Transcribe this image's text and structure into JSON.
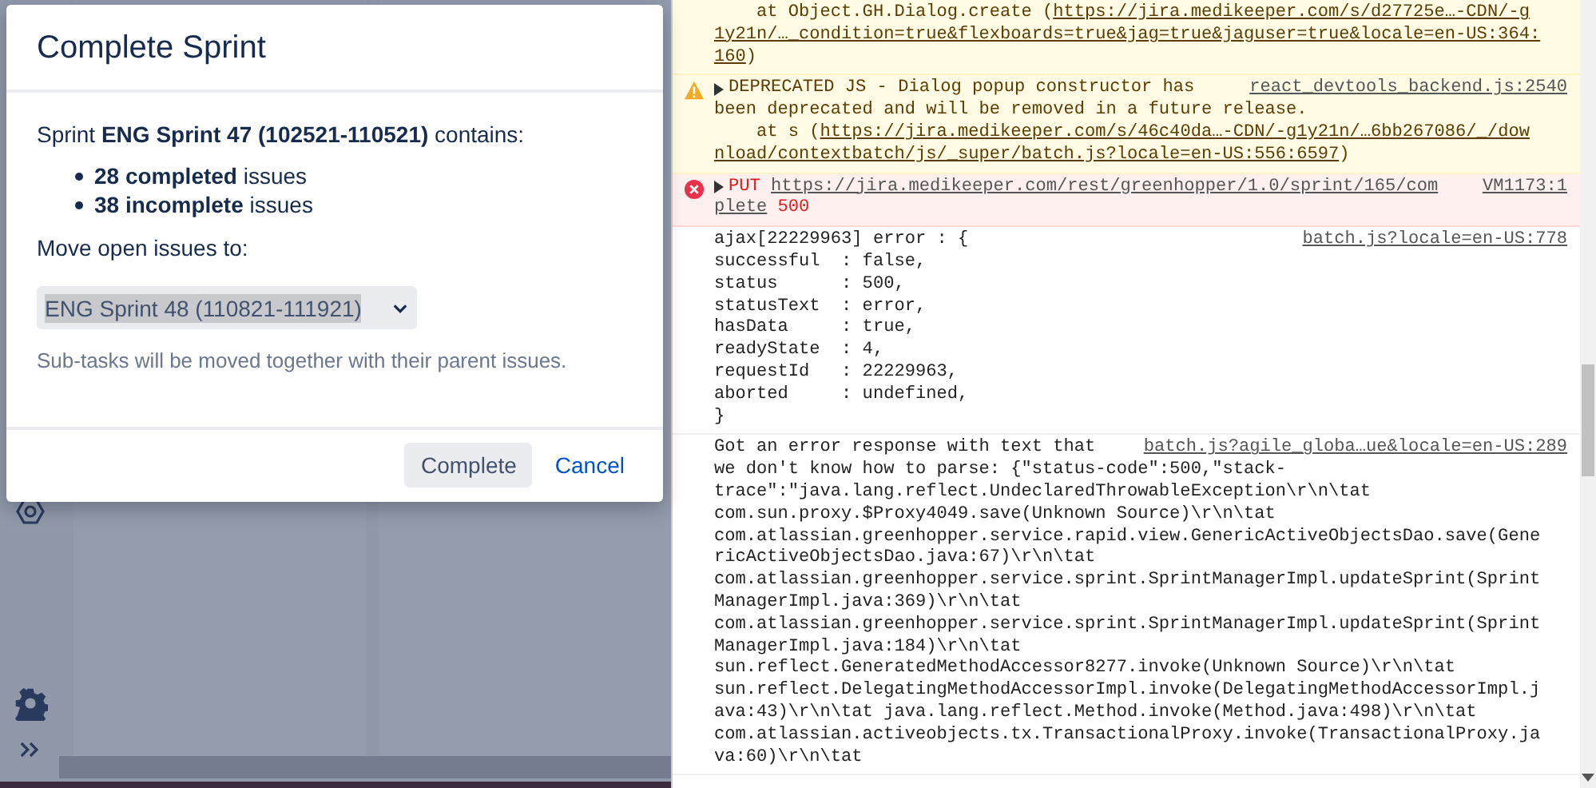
{
  "dialog": {
    "title": "Complete Sprint",
    "summary": "Sprint **ENG Sprint 47 (102521-110521)** contains:",
    "counts": [
      "**28 completed** issues",
      "**38 incomplete** issues"
    ],
    "move_label": "Move open issues to:",
    "target_select": {
      "value": "ENG Sprint 48 (110821-111921)"
    },
    "hint": "Sub-tasks will be moved together with their parent issues.",
    "buttons": [
      {
        "label": "Complete",
        "kind": "primary"
      },
      {
        "label": "Cancel",
        "kind": "link"
      }
    ]
  },
  "console": {
    "messages": [
      {
        "kind": "warning_trace",
        "lines": [
          [
            {
              "text": "    at Object.GH.Dialog.create (",
              "kind": "plain"
            },
            {
              "text": "https://jira.medikeeper.com/s/d27725e…-CDN/-g",
              "kind": "link"
            }
          ],
          [
            {
              "text": "1y21n/…_condition=true&flexboards=true&jag=true&jaguser=true&locale=en-US:364:",
              "kind": "link"
            }
          ],
          [
            {
              "text": "160",
              "kind": "link"
            },
            {
              "text": ")",
              "kind": "plain"
            }
          ]
        ]
      },
      {
        "kind": "warning",
        "source": "react_devtools_backend.js:2540",
        "lines": [
          [
            {
              "text": "DEPRECATED JS - Dialog popup constructor has",
              "kind": "plain"
            }
          ],
          [
            {
              "text": "been deprecated and will be removed in a future release.",
              "kind": "plain"
            }
          ],
          [
            {
              "text": "    at s (",
              "kind": "plain"
            },
            {
              "text": "https://jira.medikeeper.com/s/46c40da…-CDN/-g1y21n/…6bb267086/_/dow",
              "kind": "link"
            }
          ],
          [
            {
              "text": "nload/contextbatch/js/_super/batch.js?locale=en-US:556:6597",
              "kind": "link"
            },
            {
              "text": ")",
              "kind": "plain"
            }
          ]
        ]
      },
      {
        "kind": "error",
        "source": "VM1173:1",
        "lines": [
          [
            {
              "text": "PUT ",
              "kind": "error"
            },
            {
              "text": "https://jira.medikeeper.com/rest/greenhopper/1.0/sprint/165/com",
              "kind": "link"
            }
          ],
          [
            {
              "text": "plete",
              "kind": "link"
            },
            {
              "text": " 500",
              "kind": "error"
            }
          ]
        ]
      },
      {
        "kind": "log",
        "source": "batch.js?locale=en-US:778",
        "lines": [
          [
            {
              "text": "ajax[22229963] error : {",
              "kind": "plain"
            }
          ],
          [
            {
              "text": "successful  : false,",
              "kind": "plain"
            }
          ],
          [
            {
              "text": "status      : 500,",
              "kind": "plain"
            }
          ],
          [
            {
              "text": "statusText  : error,",
              "kind": "plain"
            }
          ],
          [
            {
              "text": "hasData     : true,",
              "kind": "plain"
            }
          ],
          [
            {
              "text": "readyState  : 4,",
              "kind": "plain"
            }
          ],
          [
            {
              "text": "requestId   : 22229963,",
              "kind": "plain"
            }
          ],
          [
            {
              "text": "aborted     : undefined,",
              "kind": "plain"
            }
          ],
          [
            {
              "text": "}",
              "kind": "plain"
            }
          ]
        ]
      },
      {
        "kind": "log",
        "source": "batch.js?agile_globa…ue&locale=en-US:289",
        "lines": [
          [
            {
              "text": "Got an error response with text that",
              "kind": "plain"
            }
          ],
          [
            {
              "text": "we don't know how to parse: {\"status-code\":500,\"stack-",
              "kind": "plain"
            }
          ],
          [
            {
              "text": "trace\":\"java.lang.reflect.UndeclaredThrowableException\\r\\n\\tat",
              "kind": "plain"
            }
          ],
          [
            {
              "text": "com.sun.proxy.$Proxy4049.save(Unknown Source)\\r\\n\\tat",
              "kind": "plain"
            }
          ],
          [
            {
              "text": "com.atlassian.greenhopper.service.rapid.view.GenericActiveObjectsDao.save(Gene",
              "kind": "plain"
            }
          ],
          [
            {
              "text": "ricActiveObjectsDao.java:67)\\r\\n\\tat",
              "kind": "plain"
            }
          ],
          [
            {
              "text": "com.atlassian.greenhopper.service.sprint.SprintManagerImpl.updateSprint(Sprint",
              "kind": "plain"
            }
          ],
          [
            {
              "text": "ManagerImpl.java:369)\\r\\n\\tat",
              "kind": "plain"
            }
          ],
          [
            {
              "text": "com.atlassian.greenhopper.service.sprint.SprintManagerImpl.updateSprint(Sprint",
              "kind": "plain"
            }
          ],
          [
            {
              "text": "ManagerImpl.java:184)\\r\\n\\tat",
              "kind": "plain"
            }
          ],
          [
            {
              "text": "sun.reflect.GeneratedMethodAccessor8277.invoke(Unknown Source)\\r\\n\\tat",
              "kind": "plain"
            }
          ],
          [
            {
              "text": "sun.reflect.DelegatingMethodAccessorImpl.invoke(DelegatingMethodAccessorImpl.j",
              "kind": "plain"
            }
          ],
          [
            {
              "text": "ava:43)\\r\\n\\tat java.lang.reflect.Method.invoke(Method.java:498)\\r\\n\\tat",
              "kind": "plain"
            }
          ],
          [
            {
              "text": "com.atlassian.activeobjects.tx.TransactionalProxy.invoke(TransactionalProxy.ja",
              "kind": "plain"
            }
          ],
          [
            {
              "text": "va:60)\\r\\n\\tat",
              "kind": "plain"
            }
          ]
        ]
      }
    ]
  }
}
